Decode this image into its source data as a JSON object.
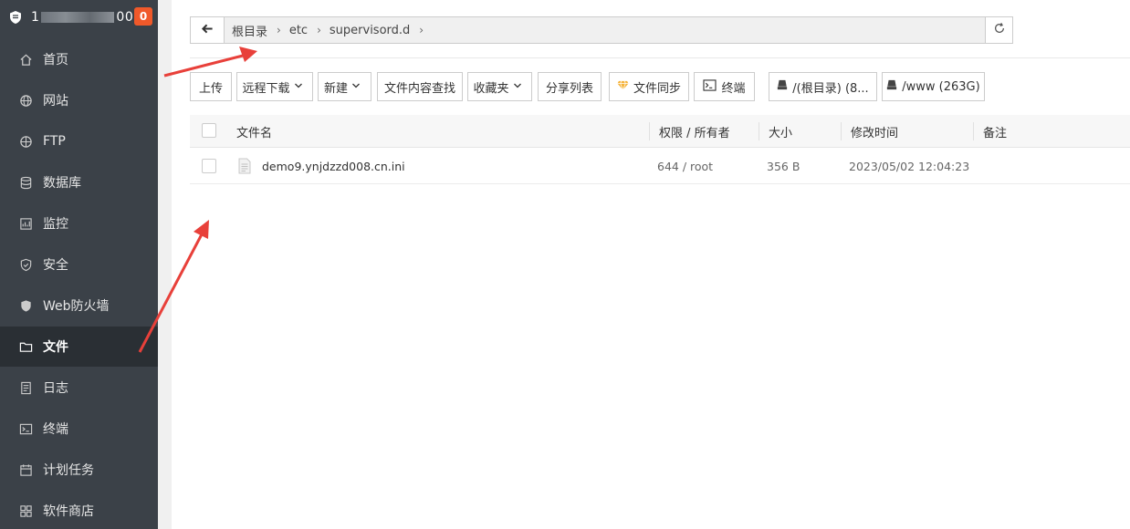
{
  "sidebar": {
    "title_prefix": "1",
    "title_suffix": "00",
    "badge": "0",
    "items": [
      {
        "label": "首页",
        "icon": "home-icon"
      },
      {
        "label": "网站",
        "icon": "globe-icon"
      },
      {
        "label": "FTP",
        "icon": "ftp-icon"
      },
      {
        "label": "数据库",
        "icon": "database-icon"
      },
      {
        "label": "监控",
        "icon": "monitor-icon"
      },
      {
        "label": "安全",
        "icon": "shield-icon"
      },
      {
        "label": "Web防火墙",
        "icon": "firewall-icon"
      },
      {
        "label": "文件",
        "icon": "folder-icon",
        "active": true
      },
      {
        "label": "日志",
        "icon": "log-icon"
      },
      {
        "label": "终端",
        "icon": "terminal-icon"
      },
      {
        "label": "计划任务",
        "icon": "calendar-icon"
      },
      {
        "label": "软件商店",
        "icon": "store-icon"
      }
    ]
  },
  "path": {
    "crumbs": [
      "根目录",
      "etc",
      "supervisord.d"
    ]
  },
  "toolbar": {
    "upload": "上传",
    "remote_download": "远程下载",
    "new": "新建",
    "content_search": "文件内容查找",
    "favorites": "收藏夹",
    "share_list": "分享列表",
    "file_sync": "文件同步",
    "terminal": "终端",
    "disk_root": "/(根目录) (8...",
    "disk_www": "/www (263G)"
  },
  "table": {
    "headers": {
      "name": "文件名",
      "perm": "权限 / 所有者",
      "size": "大小",
      "mtime": "修改时间",
      "note": "备注"
    },
    "rows": [
      {
        "name": "demo9.ynjdzzd008.cn.ini",
        "perm": "644 / root",
        "size": "356 B",
        "mtime": "2023/05/02 12:04:23",
        "note": ""
      }
    ]
  },
  "colors": {
    "sidebar_bg": "#3b4148",
    "sidebar_active": "#2a2f34",
    "badge": "#f0592a",
    "annotation_arrow": "#e8403a"
  }
}
